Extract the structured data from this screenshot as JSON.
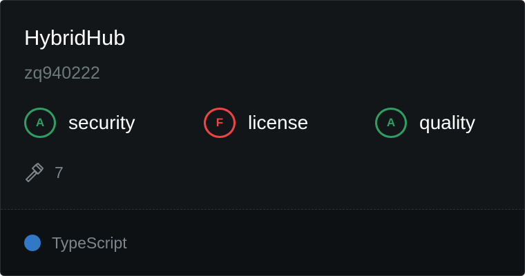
{
  "repo": {
    "name": "HybridHub",
    "owner": "zq940222"
  },
  "scores": [
    {
      "grade": "A",
      "label": "security",
      "status_color": "#2f9e63"
    },
    {
      "grade": "F",
      "label": "license",
      "status_color": "#ef4444"
    },
    {
      "grade": "A",
      "label": "quality",
      "status_color": "#2f9e63"
    }
  ],
  "stats": {
    "icon": "hammer-icon",
    "count": "7"
  },
  "footer": {
    "language": "TypeScript",
    "language_color": "#3178c6"
  }
}
